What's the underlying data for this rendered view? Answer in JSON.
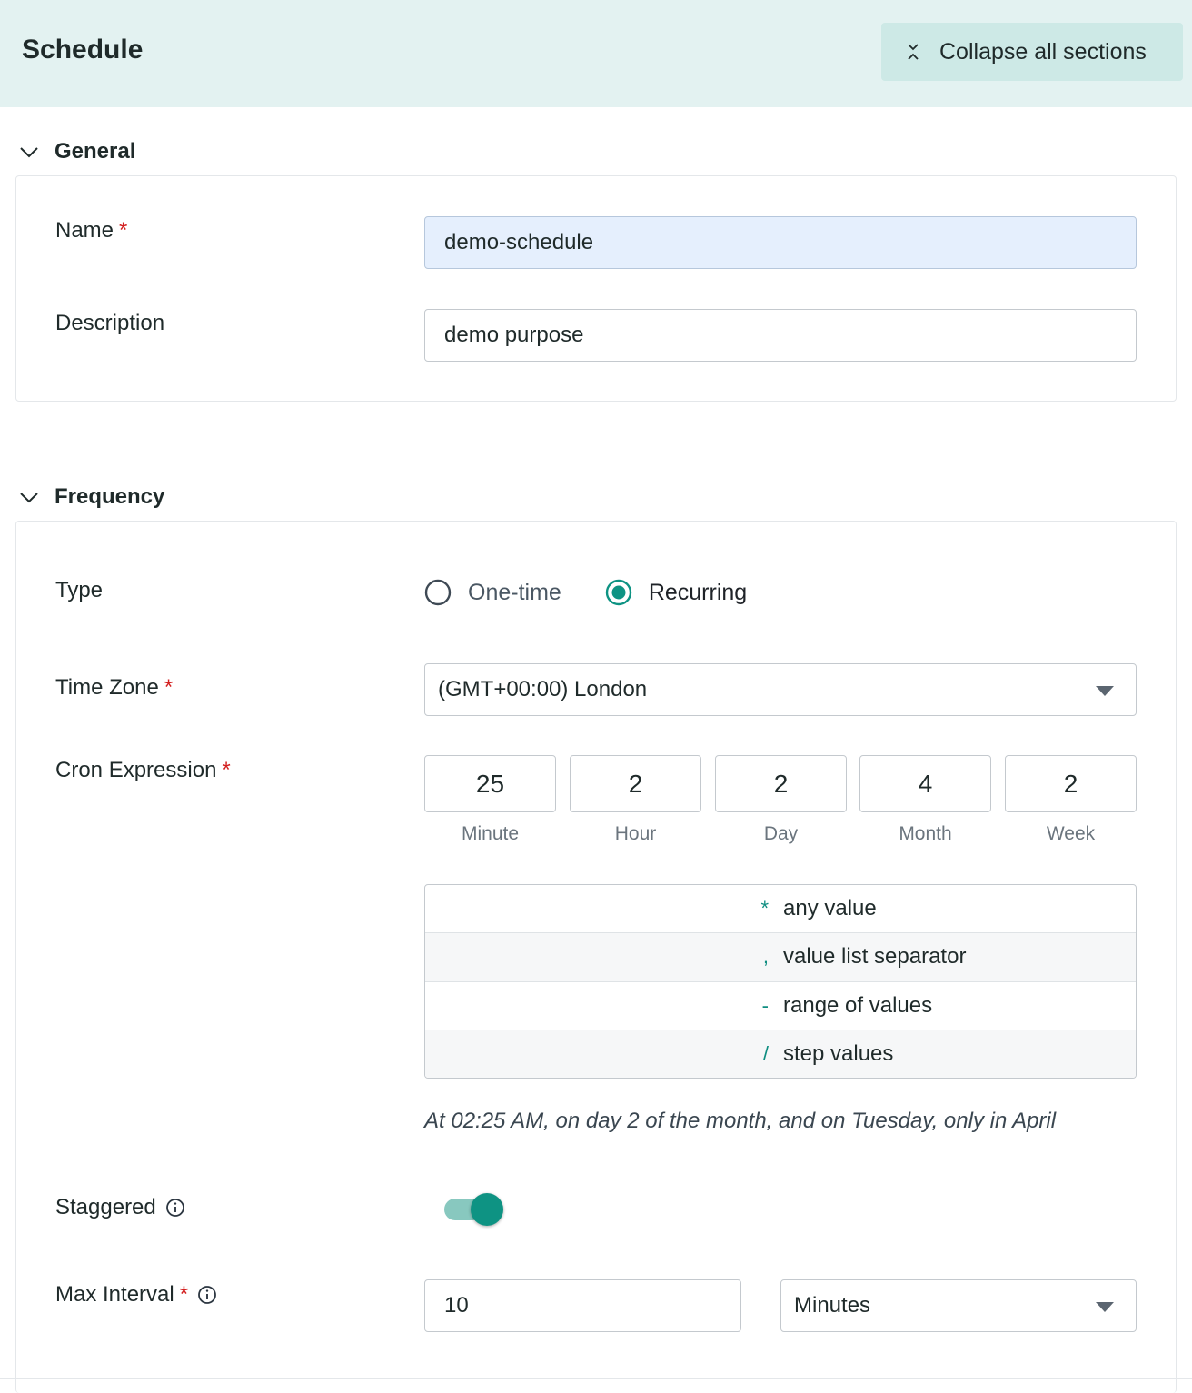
{
  "header": {
    "title": "Schedule",
    "collapse_label": "Collapse all sections"
  },
  "general": {
    "title": "General",
    "name_label": "Name",
    "name_value": "demo-schedule",
    "description_label": "Description",
    "description_value": "demo purpose"
  },
  "frequency": {
    "title": "Frequency",
    "type_label": "Type",
    "type_options": [
      "One-time",
      "Recurring"
    ],
    "type_selected": "Recurring",
    "timezone_label": "Time Zone",
    "timezone_value": "(GMT+00:00) London",
    "cron_label": "Cron Expression",
    "cron_fields": [
      {
        "value": "25",
        "caption": "Minute"
      },
      {
        "value": "2",
        "caption": "Hour"
      },
      {
        "value": "2",
        "caption": "Day"
      },
      {
        "value": "4",
        "caption": "Month"
      },
      {
        "value": "2",
        "caption": "Week"
      }
    ],
    "legend": [
      {
        "symbol": "*",
        "text": "any value"
      },
      {
        "symbol": ",",
        "text": "value list separator"
      },
      {
        "symbol": "-",
        "text": "range of values"
      },
      {
        "symbol": "/",
        "text": "step values"
      }
    ],
    "cron_description": "At 02:25 AM, on day 2 of the month, and on Tuesday, only in April",
    "staggered_label": "Staggered",
    "staggered_on": true,
    "max_interval_label": "Max Interval",
    "max_interval_value": "10",
    "max_interval_unit": "Minutes"
  },
  "required_mark": "*",
  "colors": {
    "header_bg": "#e3f2f1",
    "accent": "#0e9383",
    "required": "#d31f1f"
  }
}
